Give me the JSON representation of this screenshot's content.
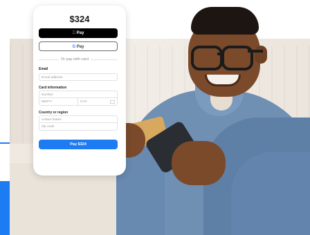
{
  "checkout": {
    "amount": "$324",
    "apple_pay_label": "Pay",
    "google_pay_label": "Pay",
    "divider_text": "Or pay with card",
    "email": {
      "label": "Email",
      "placeholder": "Email address"
    },
    "card_info": {
      "label": "Card information",
      "number_placeholder": "Number",
      "expiry_placeholder": "MM/YY",
      "cvc_placeholder": "CVC"
    },
    "country": {
      "label": "Country or region",
      "selected": "United States",
      "zip_placeholder": "Zip code"
    },
    "pay_button_label": "Pay $324"
  },
  "colors": {
    "accent": "#1d7cf2",
    "apple_pay_bg": "#000000"
  },
  "icons": [
    "apple-logo-icon",
    "google-g-icon",
    "card-cvc-icon"
  ]
}
